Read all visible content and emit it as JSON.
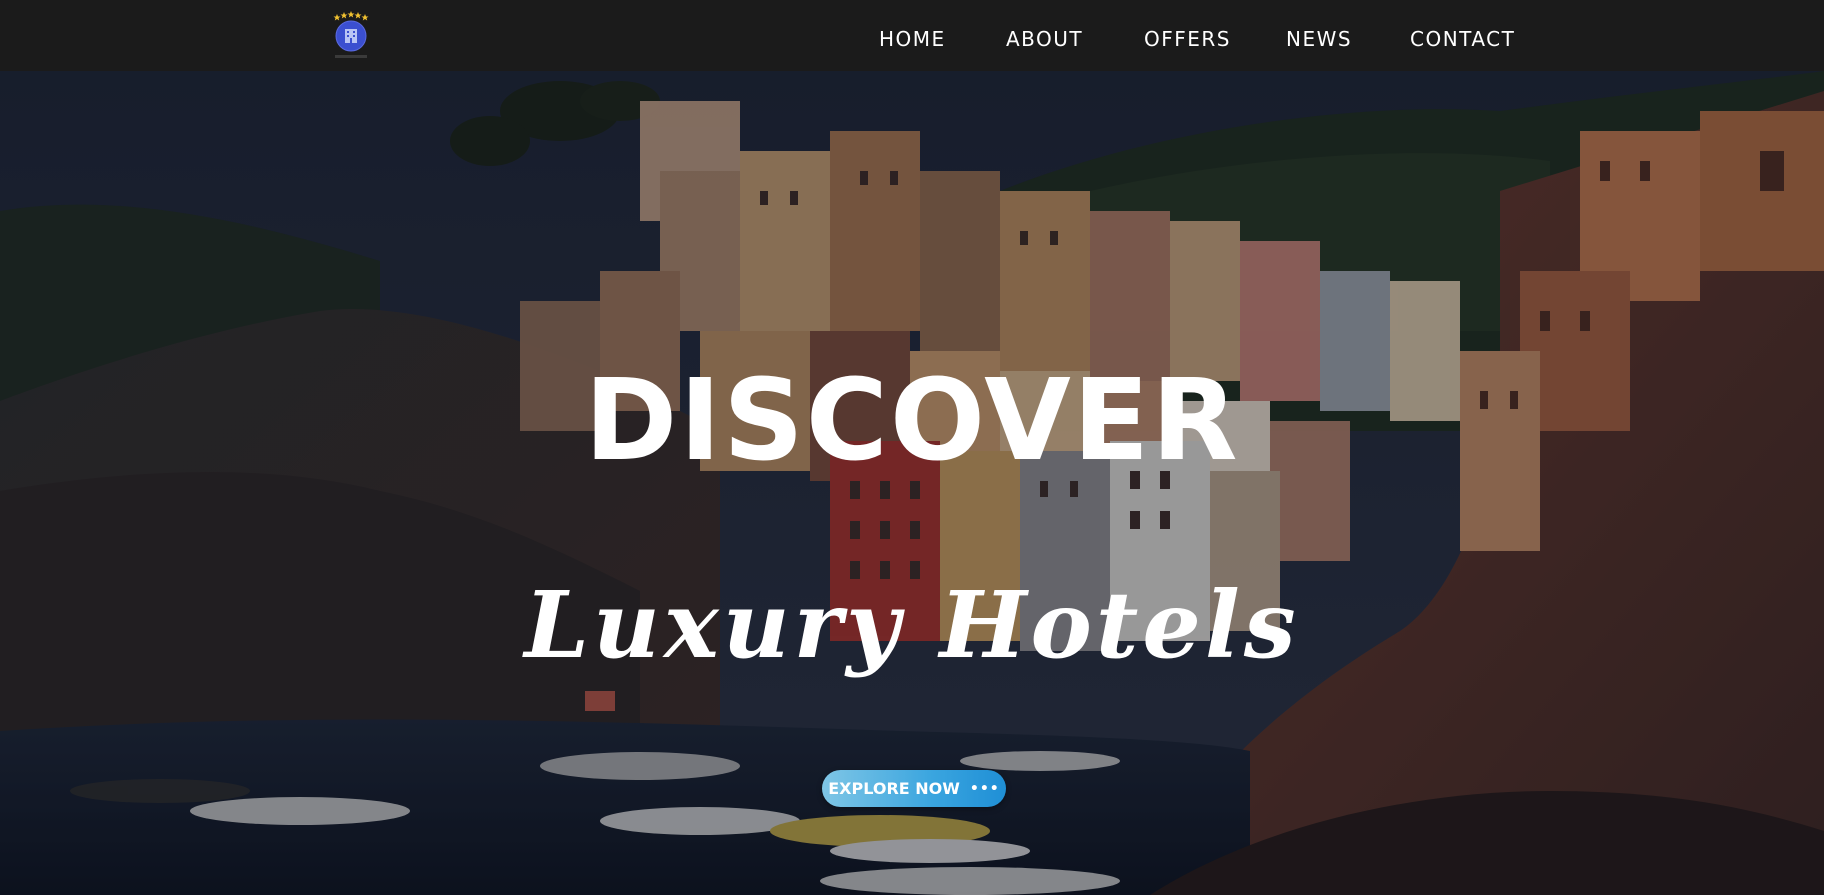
{
  "nav": {
    "logo_icon": "hotel-logo-icon",
    "items": [
      {
        "label": "HOME"
      },
      {
        "label": "ABOUT"
      },
      {
        "label": "OFFERS"
      },
      {
        "label": "NEWS"
      },
      {
        "label": "CONTACT"
      }
    ]
  },
  "hero": {
    "title": "DISCOVER",
    "subtitle": "Luxury Hotels",
    "cta_label": "EXPLORE NOW",
    "cta_icon": "dots-icon",
    "background": "coastal-village-photo"
  },
  "colors": {
    "navbar_bg": "#1b1b1b",
    "text": "#ffffff",
    "cta_gradient_start": "#7fc6e6",
    "cta_gradient_end": "#1f8fd6",
    "logo_blue": "#3b4fd0",
    "logo_stars": "#f2c230"
  }
}
